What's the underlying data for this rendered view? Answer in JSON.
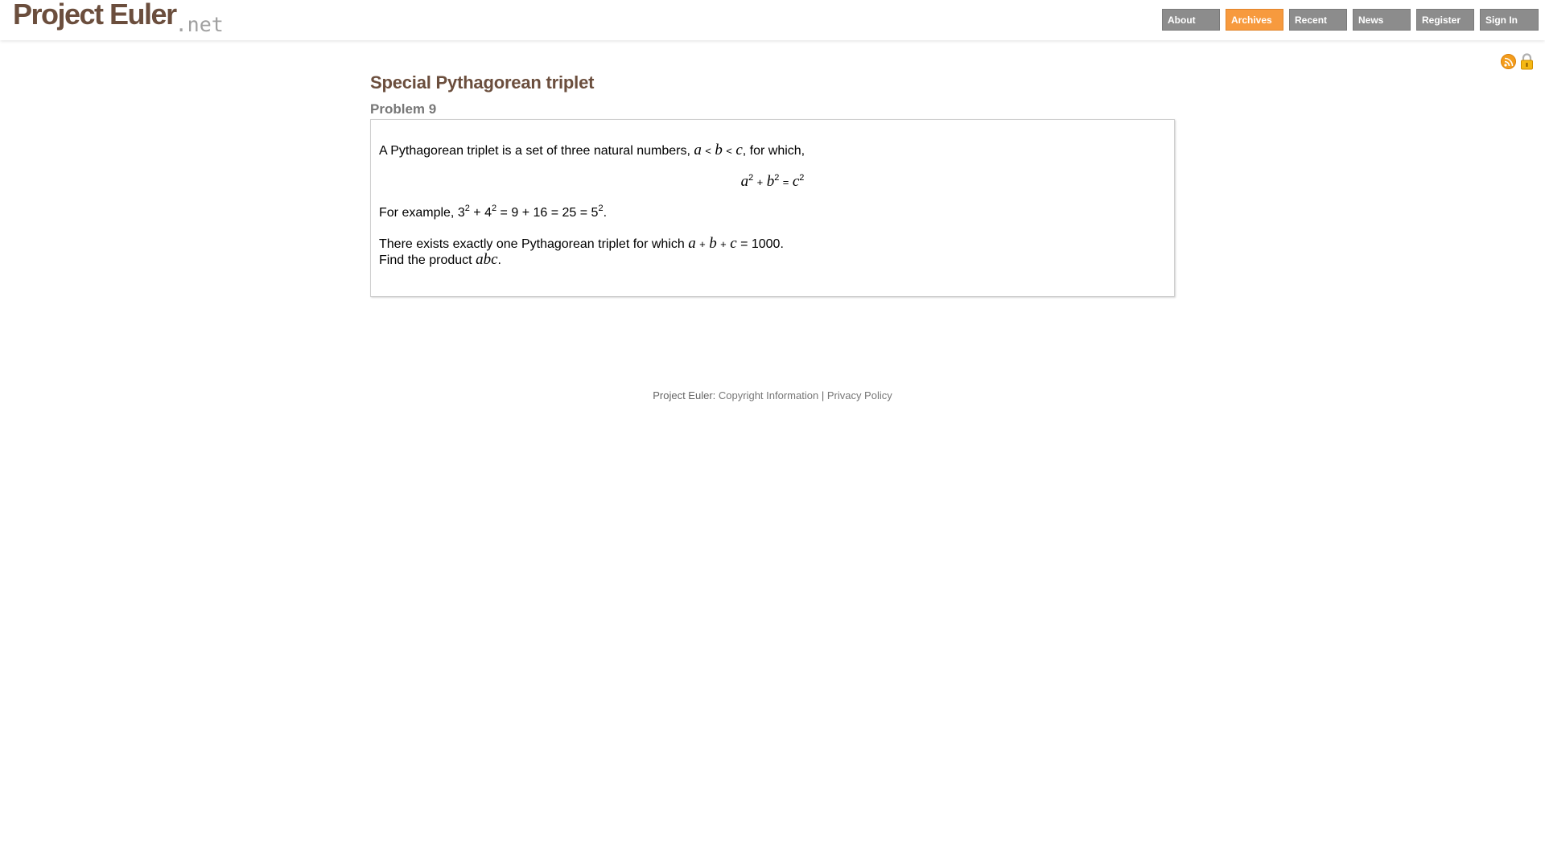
{
  "header": {
    "logo_main": "Project Euler",
    "logo_suffix": ".net",
    "nav": [
      {
        "label": "About"
      },
      {
        "label": "Archives"
      },
      {
        "label": "Recent"
      },
      {
        "label": "News"
      },
      {
        "label": "Register"
      },
      {
        "label": "Sign In"
      }
    ],
    "active_nav": "Archives",
    "icons": [
      "rss-icon",
      "lock-icon"
    ]
  },
  "problem": {
    "title": "Special Pythagorean triplet",
    "number_label": "Problem 9",
    "p1_text": "A Pythagorean triplet is a set of three natural numbers, ",
    "p1_end": ", for which,",
    "vars": {
      "a": "a",
      "b": "b",
      "c": "c",
      "abc": "abc"
    },
    "ops": {
      "lt": "<",
      "plus": "+",
      "eq": "="
    },
    "exp": "2",
    "example_prefix": "For example, ",
    "example_base1": "3",
    "example_base2": "4",
    "example_mid": " = 9 + 16 = 25 = ",
    "example_base3": "5",
    "example_end": ".",
    "p3_text": "There exists exactly one Pythagorean triplet for which ",
    "p3_end": " = 1000.",
    "p4_text": "Find the product ",
    "p4_end": "."
  },
  "footer": {
    "brand": "Project Euler:",
    "copyright_link": "Copyright Information",
    "separator": "|",
    "privacy_link": "Privacy Policy"
  },
  "colors": {
    "brand_brown": "#6b4e3d",
    "nav_gray": "#8c8c8c",
    "nav_active": "#f79a3e",
    "rss_orange": "#f39c1c"
  }
}
